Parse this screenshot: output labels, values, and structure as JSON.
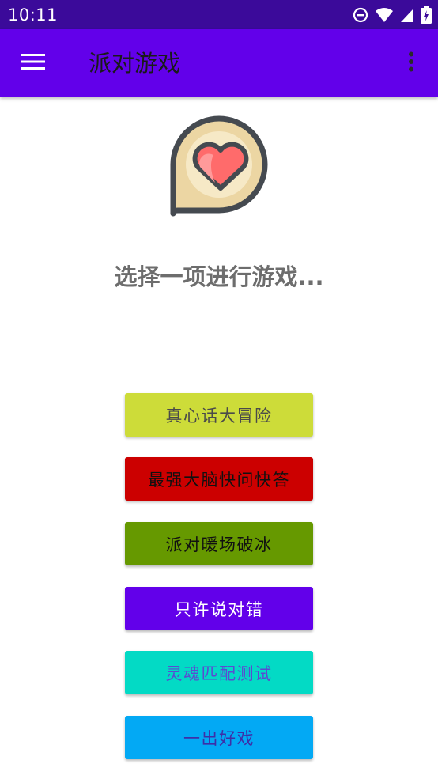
{
  "status_bar": {
    "time": "10:11",
    "icons": [
      "do-not-disturb-icon",
      "wifi-icon",
      "signal-icon",
      "battery-charging-icon"
    ],
    "background": "#3b0a9a"
  },
  "app_bar": {
    "title": "派对游戏",
    "background": "#6200ea",
    "icons": [
      "menu-icon",
      "more-vert-icon"
    ]
  },
  "main": {
    "logo_icon": "heart-chat-bubble-icon",
    "prompt": "选择一项进行游戏...",
    "games": [
      {
        "label": "真心话大冒险",
        "bg": "#cddc39",
        "fg": "#4a4a4a"
      },
      {
        "label": "最强大脑快问快答",
        "bg": "#cc0000",
        "fg": "#111111"
      },
      {
        "label": "派对暖场破冰",
        "bg": "#669900",
        "fg": "#111111"
      },
      {
        "label": "只许说对错",
        "bg": "#6200ea",
        "fg": "#ffffff"
      },
      {
        "label": "灵魂匹配测试",
        "bg": "#03dac5",
        "fg": "#5a4bd1"
      },
      {
        "label": "一出好戏",
        "bg": "#03a9f4",
        "fg": "#3d2fa8"
      }
    ]
  }
}
